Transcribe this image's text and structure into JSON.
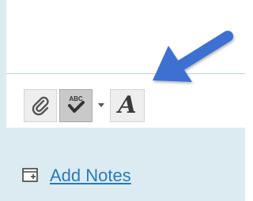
{
  "toolbar": {
    "buttons": [
      {
        "icon": "paperclip-icon",
        "action": "attach"
      },
      {
        "icon": "spellcheck-icon",
        "action": "spell-check",
        "badge": "ABC",
        "active": true
      },
      {
        "icon": "dropdown-caret-icon",
        "action": "spell-check-options"
      },
      {
        "icon": "font-format-icon",
        "action": "text-formatting",
        "glyph": "A"
      }
    ]
  },
  "notes": {
    "icon": "note-add-icon",
    "label": "Add Notes"
  },
  "annotation": {
    "icon": "pointer-arrow-icon",
    "color": "#3c6fd1"
  },
  "colors": {
    "panel_background": "#dcebf1",
    "link": "#2a7ab8"
  }
}
